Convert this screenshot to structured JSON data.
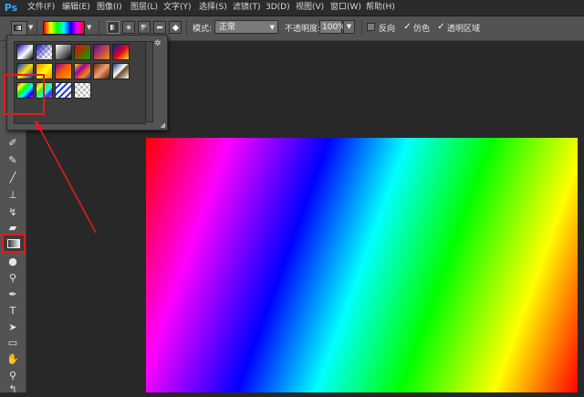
{
  "app": {
    "logo": "Ps"
  },
  "menu": [
    "文件(F)",
    "编辑(E)",
    "图像(I)",
    "图层(L)",
    "文字(Y)",
    "选择(S)",
    "滤镜(T)",
    "3D(D)",
    "视图(V)",
    "窗口(W)",
    "帮助(H)"
  ],
  "options": {
    "mode_label": "模式:",
    "mode_value": "正常",
    "opacity_label": "不透明度:",
    "opacity_value": "100%",
    "reverse_label": "反向",
    "reverse_checked": false,
    "dither_label": "仿色",
    "dither_checked": true,
    "transparency_label": "透明区域",
    "transparency_checked": true
  },
  "gradient_picker": {
    "swatches": [
      "black-white-blue",
      "checker-blue",
      "black-white",
      "red-green",
      "purple-orange",
      "blue-red-yellow",
      "blue-yellow-blue",
      "orange-yellow-orange",
      "violet-orange",
      "yellow-violet-orange-blue",
      "copper",
      "chrome",
      "spectrum",
      "transparent-rainbow",
      "transparent-stripes",
      "checker"
    ],
    "selected": "spectrum"
  },
  "colors": {
    "accent_red": "#e01c1c",
    "ps_blue": "#31a8ff"
  }
}
